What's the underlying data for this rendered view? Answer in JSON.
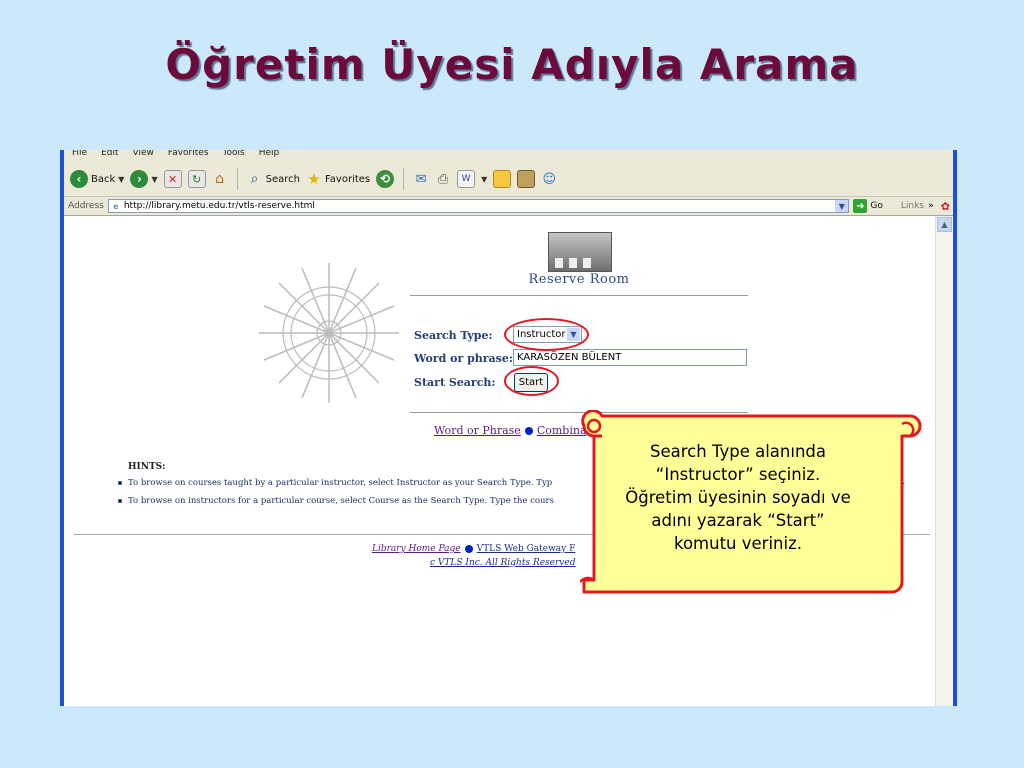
{
  "slide": {
    "title": "Öğretim Üyesi Adıyla Arama"
  },
  "browser": {
    "menu": [
      "File",
      "Edit",
      "View",
      "Favorites",
      "Tools",
      "Help"
    ],
    "toolbar": {
      "back": "Back",
      "search": "Search",
      "favorites": "Favorites"
    },
    "address_label": "Address",
    "url": "http://library.metu.edu.tr/vtls-reserve.html",
    "go": "Go",
    "links": "Links"
  },
  "page": {
    "heading": "Reserve Room",
    "labels": {
      "search_type": "Search Type:",
      "word_phrase": "Word or phrase:",
      "start_search": "Start Search:"
    },
    "search_type_value": "Instructor",
    "word_value": "KARASÖZEN BÜLENT",
    "start_button": "Start",
    "link_word": "Word or Phrase",
    "link_combined": "Combina",
    "hints_title": "HINTS:",
    "hint1": "To browse on courses taught by a particular instructor, select Instructor as your Search Type. Typ",
    "hint1_tail": "s.",
    "hint2": "To browse on instructors for a particular course, select Course as the Search Type. Type the cours",
    "footer_home": "Library Home Page",
    "footer_gateway": "VTLS Web Gateway F",
    "footer_copyright": "c VTLS Inc. All Rights Reserved"
  },
  "callout": {
    "line1": "Search Type alanında",
    "line2": "“Instructor” seçiniz.",
    "line3": "Öğretim üyesinin soyadı ve",
    "line4": "adını yazarak “Start”",
    "line5": "komutu veriniz."
  },
  "colors": {
    "slide_bg": "#cce8fb",
    "title": "#6b0a3b",
    "callout_fill": "#ffff99",
    "highlight": "#e11a22"
  }
}
